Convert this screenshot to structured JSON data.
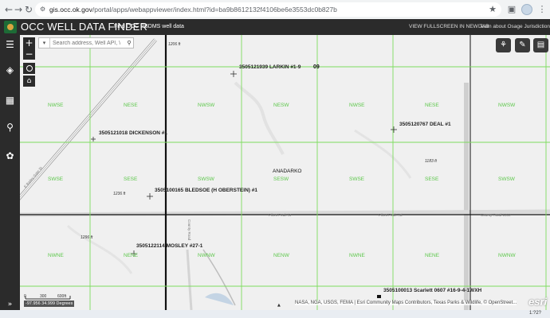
{
  "browser": {
    "url_host": "gis.occ.ok.gov",
    "url_path": "/portal/apps/webappviewer/index.html?id=ba9b8612132f4106be6e3553dc0b827b"
  },
  "header": {
    "title": "OCC WELL DATA FINDER",
    "subtitle": "Find OCC RBDMS well data",
    "fullscreen_link": "VIEW FULLSCREEN IN NEW TAB",
    "osage_link": "Learn about Osage Jurisdiction"
  },
  "search": {
    "placeholder": "Search address, Well API, \\"
  },
  "section_number": "09",
  "town": "ANADARKO",
  "wells": [
    {
      "label": "3505121939 LARKIN #1-9"
    },
    {
      "label": "3505121018 DICKENSON #1"
    },
    {
      "label": "3505120767 DEAL #1"
    },
    {
      "label": "3505100165 BLEDSOE (H OBERSTEIN) #1"
    },
    {
      "label": "3505122114 MOSLEY #27-1"
    },
    {
      "label": "3505100013 Scarlett 0607 #16-9-4-1WXH"
    }
  ],
  "quarter_labels": {
    "row1": [
      "NWSE",
      "NESE",
      "NWSW",
      "NESW",
      "NWSE",
      "NESE",
      "NWSW"
    ],
    "row2": [
      "SWSE",
      "SESE",
      "SWSW",
      "SESW",
      "SWSE",
      "SESE",
      "SWSW"
    ],
    "row3": [
      "NWNE",
      "NENE",
      "NWNW",
      "NENW",
      "NWNE",
      "NENE",
      "NWNW"
    ]
  },
  "elevations": [
    "1236 ft",
    "1296 ft",
    "1183 ft",
    "1206 ft"
  ],
  "roads": [
    "E Bailey Gate St",
    "Pikes Peak St",
    "Pikes Peak Rd",
    "County Road 1360",
    "County Road"
  ],
  "scale": {
    "labels": [
      "0",
      "300",
      "600ft"
    ]
  },
  "coordinates": "-97.956 34.999 Degrees",
  "attribution": "NASA, NGA, USGS, FEMA | Esri Community Maps Contributors, Texas Parks & Wildlife, © OpenStreet...",
  "esri_logo": "esri",
  "clock": "1:?2?",
  "colors": {
    "header_bg": "#2b2b2b",
    "plss_green": "#7ddc5e",
    "map_bg": "#f0f0f0"
  }
}
